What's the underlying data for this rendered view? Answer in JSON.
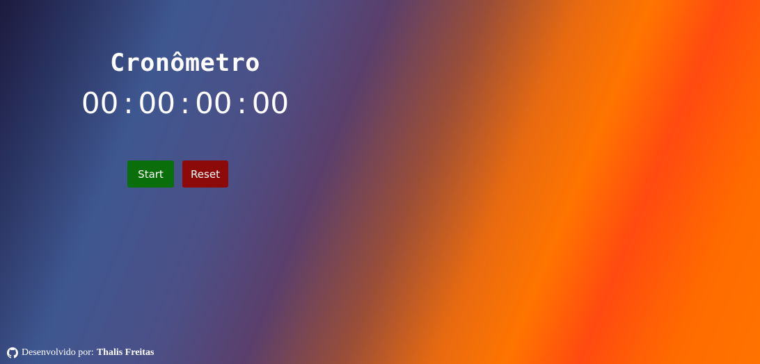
{
  "app": {
    "title": "Cronômetro"
  },
  "timer": {
    "hours": "00",
    "minutes": "00",
    "seconds": "00",
    "centiseconds": "00",
    "separator": ":"
  },
  "controls": {
    "start_label": "Start",
    "reset_label": "Reset",
    "start_color": "#0a6e0a",
    "reset_color": "#8c0a0a"
  },
  "footer": {
    "icon": "github-icon",
    "prefix": "Desenvolvido por:",
    "author": "Thalis Freitas"
  }
}
